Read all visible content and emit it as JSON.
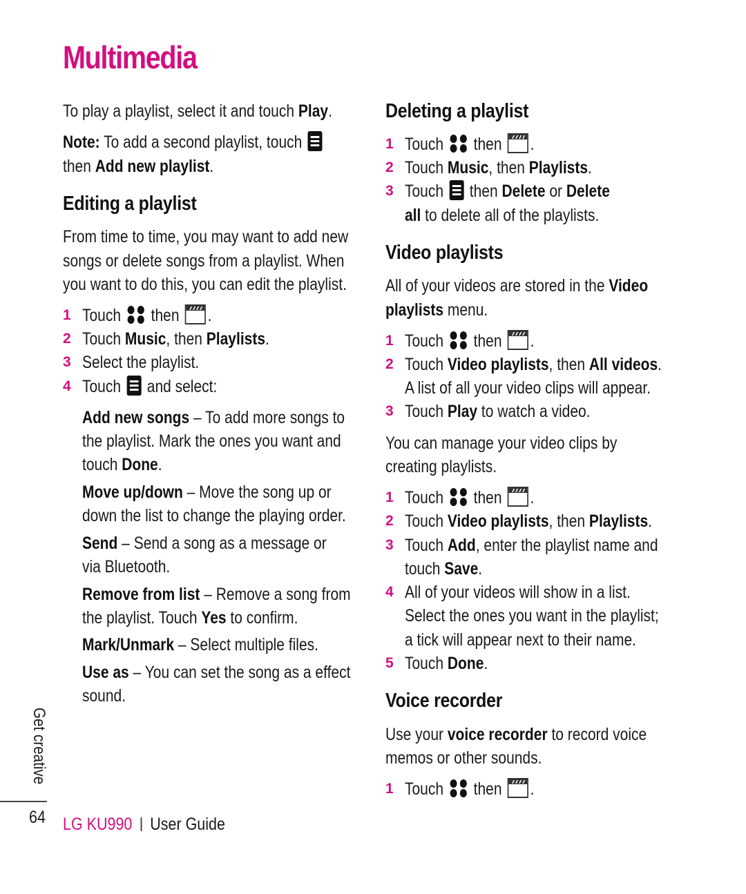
{
  "page": {
    "title": "Multimedia",
    "side_label": "Get creative",
    "page_number": "64",
    "footer": {
      "brand": "LG KU990",
      "guide": "User Guide"
    },
    "accent_color": "#d10f80"
  },
  "left": {
    "intro": {
      "pre": "To play a playlist, select it and touch ",
      "bold": "Play",
      "post": "."
    },
    "note": {
      "label": "Note:",
      "text1": " To add a second playlist, touch ",
      "icon": "menu-icon",
      "text2_pre": "then ",
      "text2_bold": "Add new playlist",
      "text2_post": "."
    },
    "editing": {
      "heading": "Editing a playlist",
      "para": [
        "From time to time, you may want to add new",
        "songs or delete songs from a playlist. When",
        "you want to do this, you can edit the playlist."
      ],
      "steps": [
        {
          "num": "1",
          "pre": "Touch ",
          "icon1": "apps-grid-icon",
          "mid": " then ",
          "icon2": "clapperboard-icon",
          "post": "."
        },
        {
          "num": "2",
          "pre": "Touch ",
          "b1": "Music",
          "mid": ", then ",
          "b2": "Playlists",
          "post": "."
        },
        {
          "num": "3",
          "text": "Select the playlist."
        },
        {
          "num": "4",
          "pre": "Touch ",
          "icon1": "menu-icon",
          "post": " and select:"
        }
      ],
      "options": [
        {
          "name": "Add new songs",
          "lines": [
            " – To add more songs to",
            "the playlist. Mark the ones you want and",
            "touch "
          ],
          "bold_end": "Done",
          "end": "."
        },
        {
          "name": "Move up/down",
          "lines": [
            " – Move the song up or",
            "down the list to change the playing order."
          ]
        },
        {
          "name": "Send",
          "lines": [
            " – Send a song as a message or",
            "via Bluetooth."
          ]
        },
        {
          "name": "Remove from list",
          "lines": [
            " – Remove a song from",
            "the playlist. Touch "
          ],
          "bold_end": "Yes",
          "end": " to confirm."
        },
        {
          "name": "Mark/Unmark",
          "lines": [
            " – Select multiple files."
          ]
        },
        {
          "name": "Use as",
          "lines": [
            " – You can set the song as a effect",
            "sound."
          ]
        }
      ]
    }
  },
  "right": {
    "deleting": {
      "heading": "Deleting a playlist",
      "steps": [
        {
          "num": "1",
          "pre": "Touch ",
          "mid": " then ",
          "post": "."
        },
        {
          "num": "2",
          "pre": "Touch ",
          "b1": "Music",
          "mid": ", then ",
          "b2": "Playlists",
          "post": "."
        },
        {
          "num": "3",
          "pre": "Touch ",
          "mid": " then ",
          "b1": "Delete",
          "or": " or ",
          "b2": "Delete",
          "line2_bold": "all",
          "line2": " to delete all of the playlists."
        }
      ]
    },
    "video": {
      "heading": "Video playlists",
      "intro": {
        "pre": "All of your videos are stored in the ",
        "bold1": "Video",
        "bold2": "playlists",
        "post": " menu."
      },
      "steps_a": [
        {
          "num": "1",
          "pre": "Touch ",
          "mid": " then ",
          "post": "."
        },
        {
          "num": "2",
          "pre": "Touch ",
          "b1": "Video playlists",
          "mid": ", then ",
          "b2": "All videos",
          "post": ".",
          "line2": "A list of all your video clips will appear."
        },
        {
          "num": "3",
          "pre": "Touch ",
          "b1": "Play",
          "post": " to watch a video."
        }
      ],
      "para": [
        "You can manage your video clips by",
        "creating playlists."
      ],
      "steps_b": [
        {
          "num": "1",
          "pre": "Touch ",
          "mid": " then ",
          "post": "."
        },
        {
          "num": "2",
          "pre": "Touch ",
          "b1": "Video playlists",
          "mid": ", then ",
          "b2": "Playlists",
          "post": "."
        },
        {
          "num": "3",
          "pre": "Touch ",
          "b1": "Add",
          "mid": ", enter the playlist name and",
          "line2_pre": "touch ",
          "line2_bold": "Save",
          "line2_post": "."
        },
        {
          "num": "4",
          "lines": [
            "All of your videos will show in a list.",
            "Select the ones you want in the playlist;",
            "a tick will appear next to their name."
          ]
        },
        {
          "num": "5",
          "pre": "Touch ",
          "b1": "Done",
          "post": "."
        }
      ]
    },
    "voice": {
      "heading": "Voice recorder",
      "intro": {
        "pre": "Use your ",
        "bold": "voice recorder",
        "post": " to record voice",
        "line2": "memos or other sounds."
      },
      "steps": [
        {
          "num": "1",
          "pre": "Touch ",
          "mid": " then ",
          "post": "."
        }
      ]
    }
  }
}
